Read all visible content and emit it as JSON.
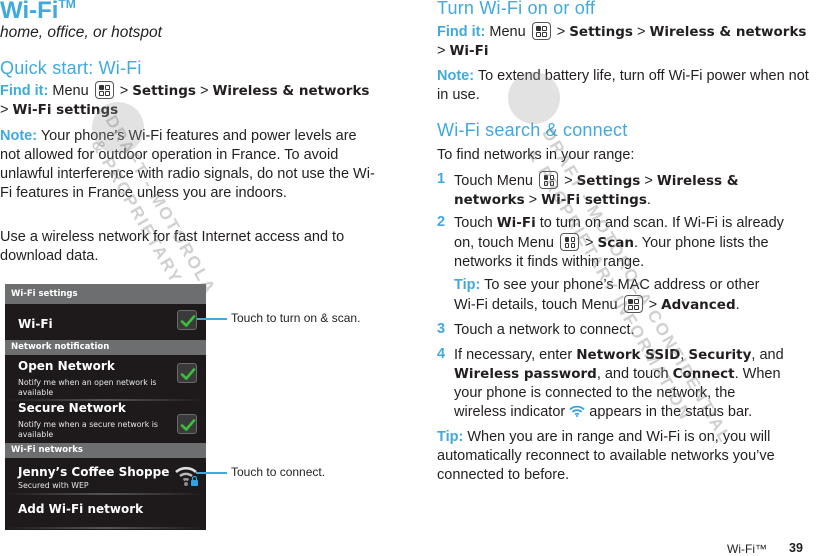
{
  "page": {
    "title": "Wi-Fi",
    "title_mark": "TM",
    "subtitle": "home, office, or hotspot",
    "footer_section": "Wi-Fi™",
    "page_number": "39"
  },
  "quick_start": {
    "heading": "Quick start: Wi-Fi",
    "find_it_label": "Find it:",
    "find_it_menu": "Menu",
    "path": [
      ">",
      "Settings",
      ">",
      "Wireless & networks",
      ">",
      "Wi-Fi settings"
    ],
    "note_label": "Note:",
    "note_text": "Your phone's Wi-Fi features and power levels are not allowed for outdoor operation in France. To avoid unlawful interference with radio signals, do not use the Wi-Fi features in France unless you are indoors.",
    "body_text": "Use a wireless network for fast Internet access and to download data."
  },
  "phone_screen": {
    "header": "Wi-Fi settings",
    "wifi_label": "Wi-Fi",
    "wifi_checked": true,
    "section_notification": "Network notification",
    "open_network": {
      "title": "Open Network",
      "desc": "Notify me when an open network is available",
      "checked": true
    },
    "secure_network": {
      "title": "Secure Network",
      "desc": "Notify me when a secure network is available",
      "checked": true
    },
    "section_networks": "Wi-Fi networks",
    "network": {
      "name": "Jenny’s Coffee Shoppe",
      "security": "Secured with WEP",
      "icon": "wifi-locked-icon"
    },
    "add_network": "Add Wi-Fi network"
  },
  "callouts": {
    "wifi_toggle": "Touch to turn on & scan.",
    "network_connect": "Touch to connect."
  },
  "turn_on_off": {
    "heading": "Turn Wi-Fi on or off",
    "find_it_label": "Find it:",
    "find_it_menu": "Menu",
    "path": [
      ">",
      "Settings",
      ">",
      "Wireless & networks",
      ">",
      "Wi-Fi"
    ],
    "note_label": "Note:",
    "note_text": "To extend battery life, turn off Wi-Fi power when not in use."
  },
  "search_connect": {
    "heading": "Wi-Fi search & connect",
    "intro": "To find networks in your range:",
    "steps": [
      {
        "num": "1",
        "t1": "Touch Menu",
        "t2": ">",
        "b1": "Settings",
        "t3": ">",
        "b2": "Wireless &",
        "b3": "networks",
        "t4": ">",
        "b4": "Wi-Fi settings",
        "t5": "."
      },
      {
        "num": "2",
        "t1": "Touch",
        "b1": "Wi-Fi",
        "t2": "to turn on and scan. If Wi-Fi is already",
        "t3": "on, touch Menu",
        "t4": ">",
        "b2": "Scan",
        "t5": ". Your phone lists the",
        "t6": "networks it finds within range."
      },
      {
        "num": "3",
        "text": "Touch a network to connect."
      },
      {
        "num": "4",
        "t1": "If necessary, enter",
        "b1": "Network SSID",
        "t2": ",",
        "b2": "Security",
        "t3": ", and",
        "b3": "Wireless password",
        "t4": ", and touch",
        "b4": "Connect",
        "t5": ". When",
        "t6": "your phone is connected to the network, the",
        "t7": "wireless indicator",
        "t8": "appears in the status bar."
      }
    ],
    "tip1_label": "Tip:",
    "tip1_l1": "To see your phone’s MAC address or other",
    "tip1_l2a": "Wi-Fi details, touch Menu",
    "tip1_l2b": ">",
    "tip1_bold": "Advanced",
    "tip1_end": ".",
    "tip2_label": "Tip:",
    "tip2_text": "When you are in range and Wi-Fi is on, you will automatically reconnect to available networks you’ve connected to before."
  },
  "watermarks": {
    "left_1": "DRAFT - MOTOROLA",
    "left_2": "& PROPRIETARY",
    "right_1": "DRAFT - MOTOROLA CONFIDENTIAL",
    "right_2": "& PROPRIETARY INFORMATION"
  },
  "colors": {
    "accent": "#3fa9e0",
    "text": "#231f20",
    "phone_bg": "#1e1a1b",
    "phone_header": "#6d6e70",
    "check_green": "#3dbd3d"
  }
}
